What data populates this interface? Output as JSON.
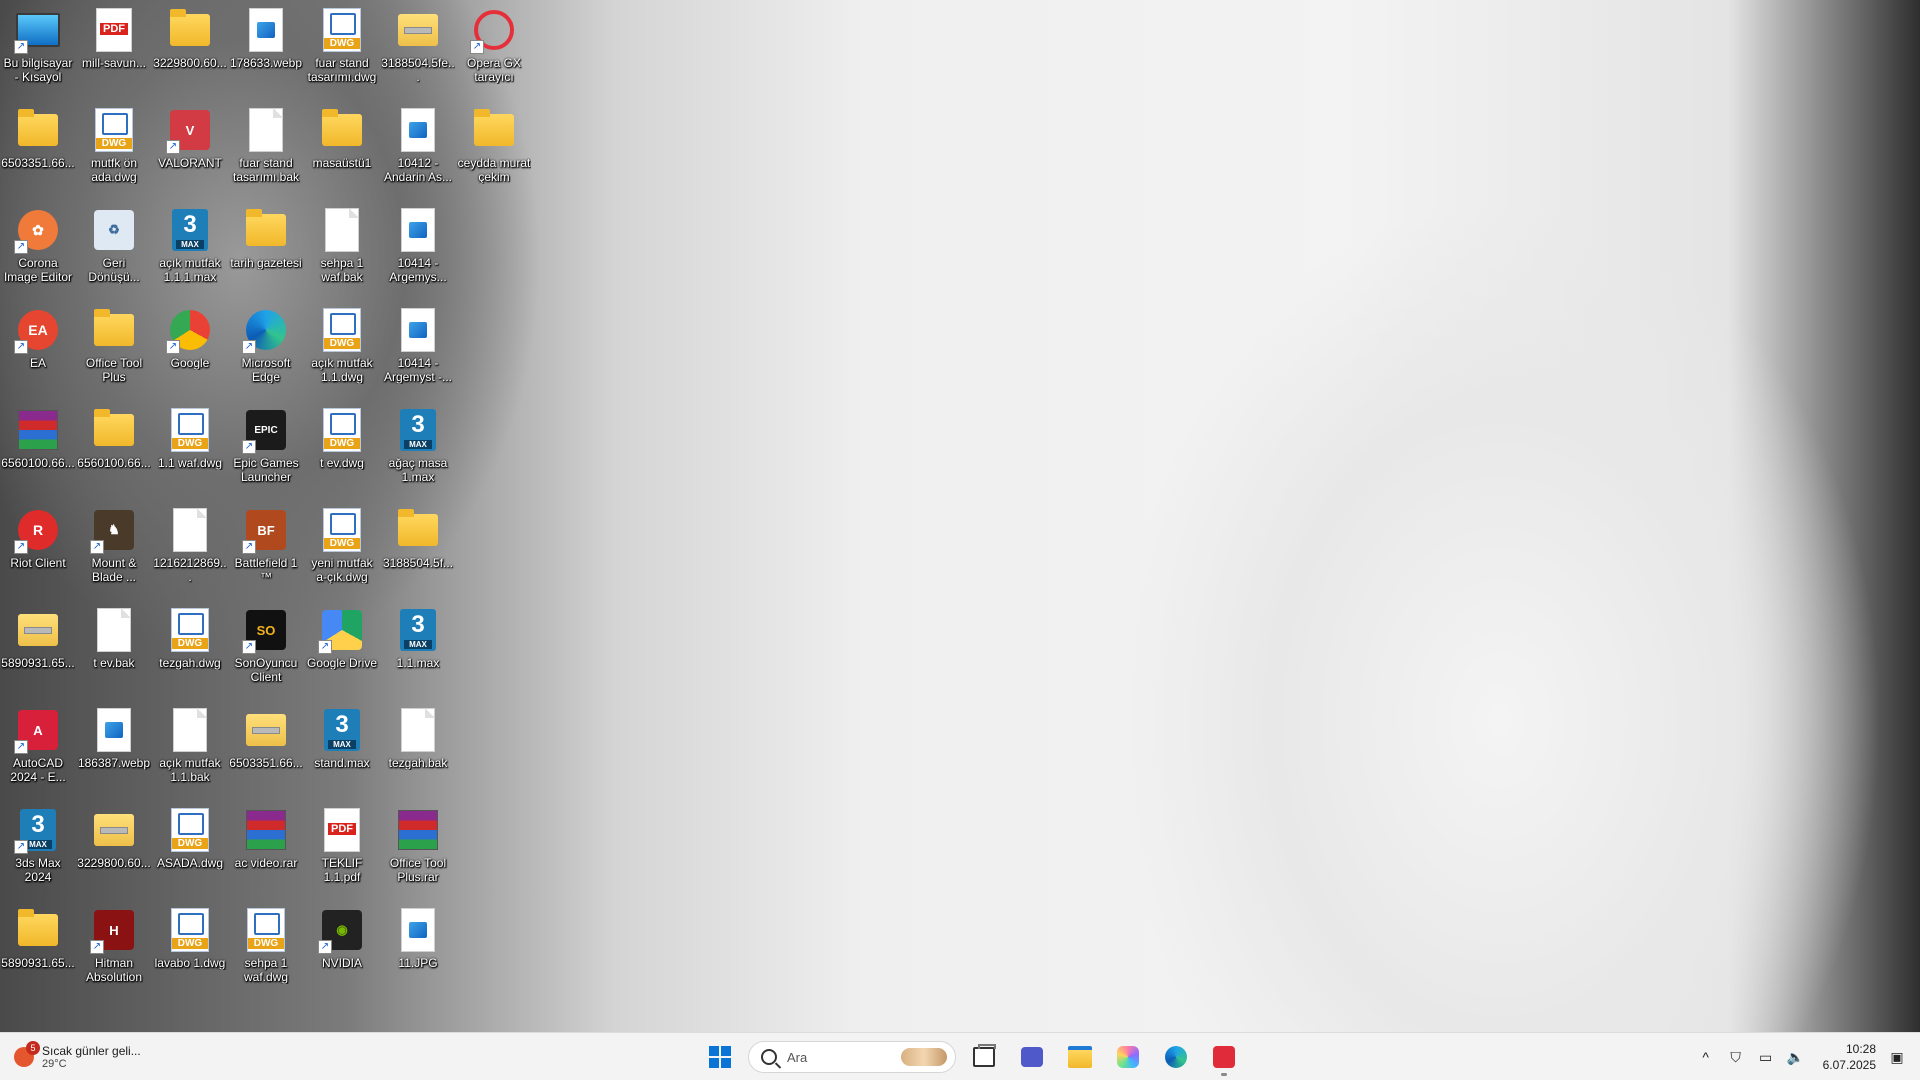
{
  "desktop": {
    "icons": [
      {
        "label": "Bu bilgisayar - Kısayol",
        "type": "pc",
        "shortcut": true
      },
      {
        "label": "6503351.66...",
        "type": "folder",
        "shortcut": false
      },
      {
        "label": "Corona Image Editor",
        "type": "corona",
        "shortcut": true
      },
      {
        "label": "EA",
        "type": "ea",
        "shortcut": true
      },
      {
        "label": "6560100.66...",
        "type": "rar",
        "shortcut": false
      },
      {
        "label": "Riot Client",
        "type": "riot",
        "shortcut": true
      },
      {
        "label": "5890931.65...",
        "type": "zip",
        "shortcut": false
      },
      {
        "label": "AutoCAD 2024 - E...",
        "type": "autocad",
        "shortcut": true
      },
      {
        "label": "3ds Max 2024",
        "type": "max",
        "shortcut": true
      },
      {
        "label": "5890931.65...",
        "type": "folder",
        "shortcut": false
      },
      {
        "label": "mill-savun...",
        "type": "pdf",
        "shortcut": false
      },
      {
        "label": "mutfk ön ada.dwg",
        "type": "dwg",
        "shortcut": false
      },
      {
        "label": "Geri Dönüşü...",
        "type": "recycle",
        "shortcut": false
      },
      {
        "label": "Office Tool Plus",
        "type": "folder",
        "shortcut": false
      },
      {
        "label": "6560100.66...",
        "type": "folder",
        "shortcut": false
      },
      {
        "label": "Mount & Blade ...",
        "type": "game",
        "shortcut": true
      },
      {
        "label": "t ev.bak",
        "type": "file",
        "shortcut": false
      },
      {
        "label": "186387.webp",
        "type": "image",
        "shortcut": false
      },
      {
        "label": "3229800.60...",
        "type": "zip",
        "shortcut": false
      },
      {
        "label": "Hitman Absolution",
        "type": "hitman",
        "shortcut": true
      },
      {
        "label": "3229800.60...",
        "type": "folder",
        "shortcut": false
      },
      {
        "label": "VALORANT",
        "type": "valorant",
        "shortcut": true
      },
      {
        "label": "açık mutfak 1.1.1.max",
        "type": "max",
        "shortcut": false
      },
      {
        "label": "Google",
        "type": "chrome",
        "shortcut": true
      },
      {
        "label": "1.1 waf.dwg",
        "type": "dwg",
        "shortcut": false
      },
      {
        "label": "1216212869...",
        "type": "file",
        "shortcut": false
      },
      {
        "label": "tezgah.dwg",
        "type": "dwg",
        "shortcut": false
      },
      {
        "label": "açık mutfak 1.1.bak",
        "type": "file",
        "shortcut": false
      },
      {
        "label": "ASADA.dwg",
        "type": "dwg",
        "shortcut": false
      },
      {
        "label": "lavabo 1.dwg",
        "type": "dwg",
        "shortcut": false
      },
      {
        "label": "178633.webp",
        "type": "image",
        "shortcut": false
      },
      {
        "label": "fuar stand tasarımı.bak",
        "type": "file",
        "shortcut": false
      },
      {
        "label": "tarih gazetesi",
        "type": "folder",
        "shortcut": false
      },
      {
        "label": "Microsoft Edge",
        "type": "edge",
        "shortcut": true
      },
      {
        "label": "Epic Games Launcher",
        "type": "epic",
        "shortcut": true
      },
      {
        "label": "Battlefield 1 ™",
        "type": "battlefield",
        "shortcut": true
      },
      {
        "label": "SonOyuncu Client",
        "type": "sonoyuncu",
        "shortcut": true
      },
      {
        "label": "6503351.66...",
        "type": "zip",
        "shortcut": false
      },
      {
        "label": "ac video.rar",
        "type": "rar",
        "shortcut": false
      },
      {
        "label": "sehpa 1 waf.dwg",
        "type": "dwg",
        "shortcut": false
      },
      {
        "label": "fuar stand tasarımı.dwg",
        "type": "dwg",
        "shortcut": false
      },
      {
        "label": "masaüstü1",
        "type": "folder",
        "shortcut": false
      },
      {
        "label": "sehpa 1 waf.bak",
        "type": "file",
        "shortcut": false
      },
      {
        "label": "açık mutfak 1.1.dwg",
        "type": "dwg",
        "shortcut": false
      },
      {
        "label": "t ev.dwg",
        "type": "dwg",
        "shortcut": false
      },
      {
        "label": "yeni mutfak a-çık.dwg",
        "type": "dwg",
        "shortcut": false
      },
      {
        "label": "Google Drive",
        "type": "gdrive",
        "shortcut": true
      },
      {
        "label": "stand.max",
        "type": "max",
        "shortcut": false
      },
      {
        "label": "TEKLIF 1.1.pdf",
        "type": "pdf",
        "shortcut": false
      },
      {
        "label": "NVIDIA",
        "type": "nvidia",
        "shortcut": true
      },
      {
        "label": "3188504.5fe...",
        "type": "zip",
        "shortcut": false
      },
      {
        "label": "10412 - Andarin As...",
        "type": "image",
        "shortcut": false
      },
      {
        "label": "10414 - Argemys...",
        "type": "image",
        "shortcut": false
      },
      {
        "label": "10414 - Argemyst -...",
        "type": "image",
        "shortcut": false
      },
      {
        "label": "ağaç masa 1.max",
        "type": "max",
        "shortcut": false
      },
      {
        "label": "3188504.5f...",
        "type": "folder",
        "shortcut": false
      },
      {
        "label": "1.1.max",
        "type": "max",
        "shortcut": false
      },
      {
        "label": "tezgah.bak",
        "type": "file",
        "shortcut": false
      },
      {
        "label": "Office Tool Plus.rar",
        "type": "rar",
        "shortcut": false
      },
      {
        "label": "11.JPG",
        "type": "image",
        "shortcut": false
      },
      {
        "label": "Opera GX tarayıcı",
        "type": "opera",
        "shortcut": true
      },
      {
        "label": "ceydda murat çekim",
        "type": "folder",
        "shortcut": false
      }
    ]
  },
  "taskbar": {
    "weather": {
      "badge": "5",
      "text": "Sıcak günler geli...",
      "temp": "29°C"
    },
    "search_placeholder": "Ara",
    "pinned": [
      {
        "name": "start-button",
        "icon": "windows-icon"
      },
      {
        "name": "task-view-button",
        "icon": "task-view-icon"
      },
      {
        "name": "teams-button",
        "icon": "teams-icon"
      },
      {
        "name": "file-explorer-button",
        "icon": "folder-icon"
      },
      {
        "name": "copilot-button",
        "icon": "copilot-icon"
      },
      {
        "name": "edge-button",
        "icon": "edge-icon"
      },
      {
        "name": "app-red-button",
        "icon": "app-icon"
      }
    ],
    "tray": {
      "chevron": "^",
      "time": "10:28",
      "date": "6.07.2025"
    }
  }
}
